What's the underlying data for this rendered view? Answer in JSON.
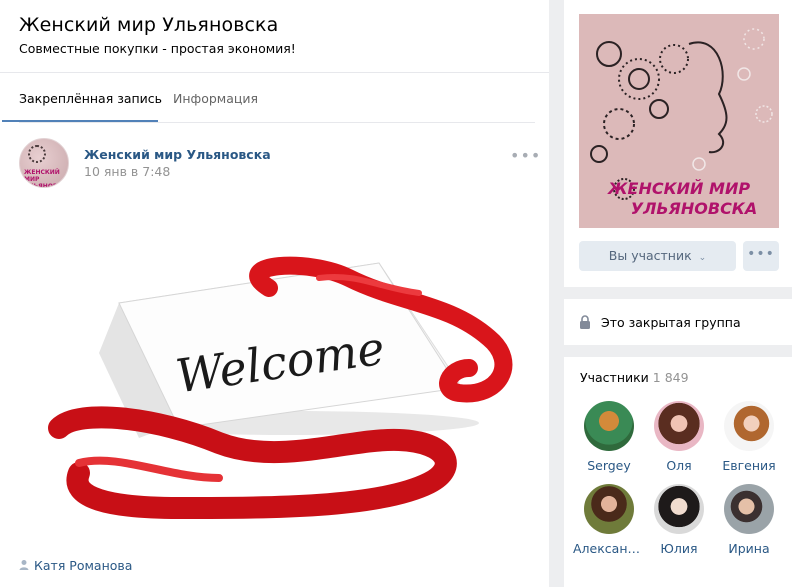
{
  "group": {
    "title": "Женский мир Ульяновска",
    "status": "Совместные покупки - простая экономия!"
  },
  "tabs": [
    {
      "label": "Закреплённая запись",
      "active": true
    },
    {
      "label": "Информация",
      "active": false
    }
  ],
  "post": {
    "author": "Женский мир Ульяновска",
    "date": "10 янв в 7:48",
    "image_text": "Welcome",
    "avatar_text": "ЖЕНСКИЙ МИР УЛЬЯНОВСКА",
    "signer": "Катя Романова",
    "more_icon": "ellipsis-icon"
  },
  "sidebar": {
    "cover_text_line1": "ЖЕНСКИЙ МИР",
    "cover_text_line2": "УЛЬЯНОВСКА",
    "join_label": "Вы участник",
    "join_icon": "chevron-down-icon",
    "more_label": "•••",
    "closed_label": "Это закрытая группа",
    "members_title": "Участники",
    "members_count": "1 849",
    "members": [
      {
        "name": "Sergey"
      },
      {
        "name": "Оля"
      },
      {
        "name": "Евгения"
      },
      {
        "name": "Александ..."
      },
      {
        "name": "Юлия"
      },
      {
        "name": "Ирина"
      }
    ]
  },
  "colors": {
    "link": "#2a5885",
    "tab_underline": "#5181b8",
    "button_bg": "#e5ebf1",
    "ribbon_red": "#d9151b",
    "cover_bg": "#dcb9b9",
    "cover_text": "#b0126b"
  }
}
